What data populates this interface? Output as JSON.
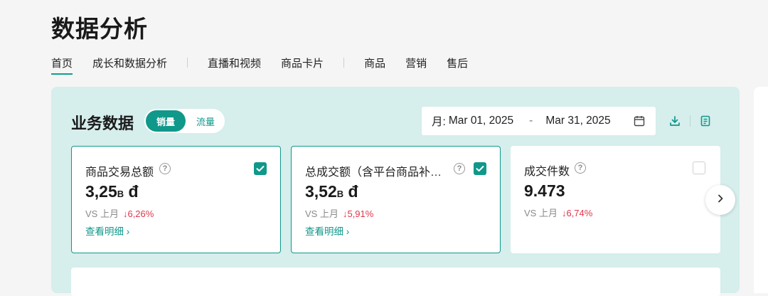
{
  "page_title": "数据分析",
  "tabs": [
    {
      "label": "首页",
      "active": true
    },
    {
      "label": "成长和数据分析"
    },
    {
      "label": "直播和视频"
    },
    {
      "label": "商品卡片"
    },
    {
      "label": "商品"
    },
    {
      "label": "营销"
    },
    {
      "label": "售后"
    }
  ],
  "section": {
    "title": "业务数据",
    "toggle": {
      "selected": "销量",
      "other": "流量"
    }
  },
  "date_range": {
    "prefix": "月:",
    "start": "Mar 01, 2025",
    "separator": "-",
    "end": "Mar 31, 2025"
  },
  "icons": {
    "calendar": "calendar-icon",
    "download": "download-icon",
    "report": "report-icon",
    "next": "chevron-right-icon"
  },
  "colors": {
    "accent": "#10988a",
    "panel_bg": "#d6eeec",
    "decrease": "#e0364a"
  },
  "cards": [
    {
      "label": "商品交易总额",
      "value": "3,25",
      "unit": "B",
      "currency": "đ",
      "compare_label": "VS 上月",
      "change": "6,26%",
      "detail": "查看明细 ›",
      "checked": true
    },
    {
      "label": "总成交额（含平台商品补…",
      "value": "3,52",
      "unit": "B",
      "currency": "đ",
      "compare_label": "VS 上月",
      "change": "5,91%",
      "detail": "查看明细 ›",
      "checked": true
    },
    {
      "label": "成交件数",
      "value": "9.473",
      "compare_label": "VS 上月",
      "change": "6,74%",
      "checked": false
    }
  ],
  "change_arrow": "↓"
}
